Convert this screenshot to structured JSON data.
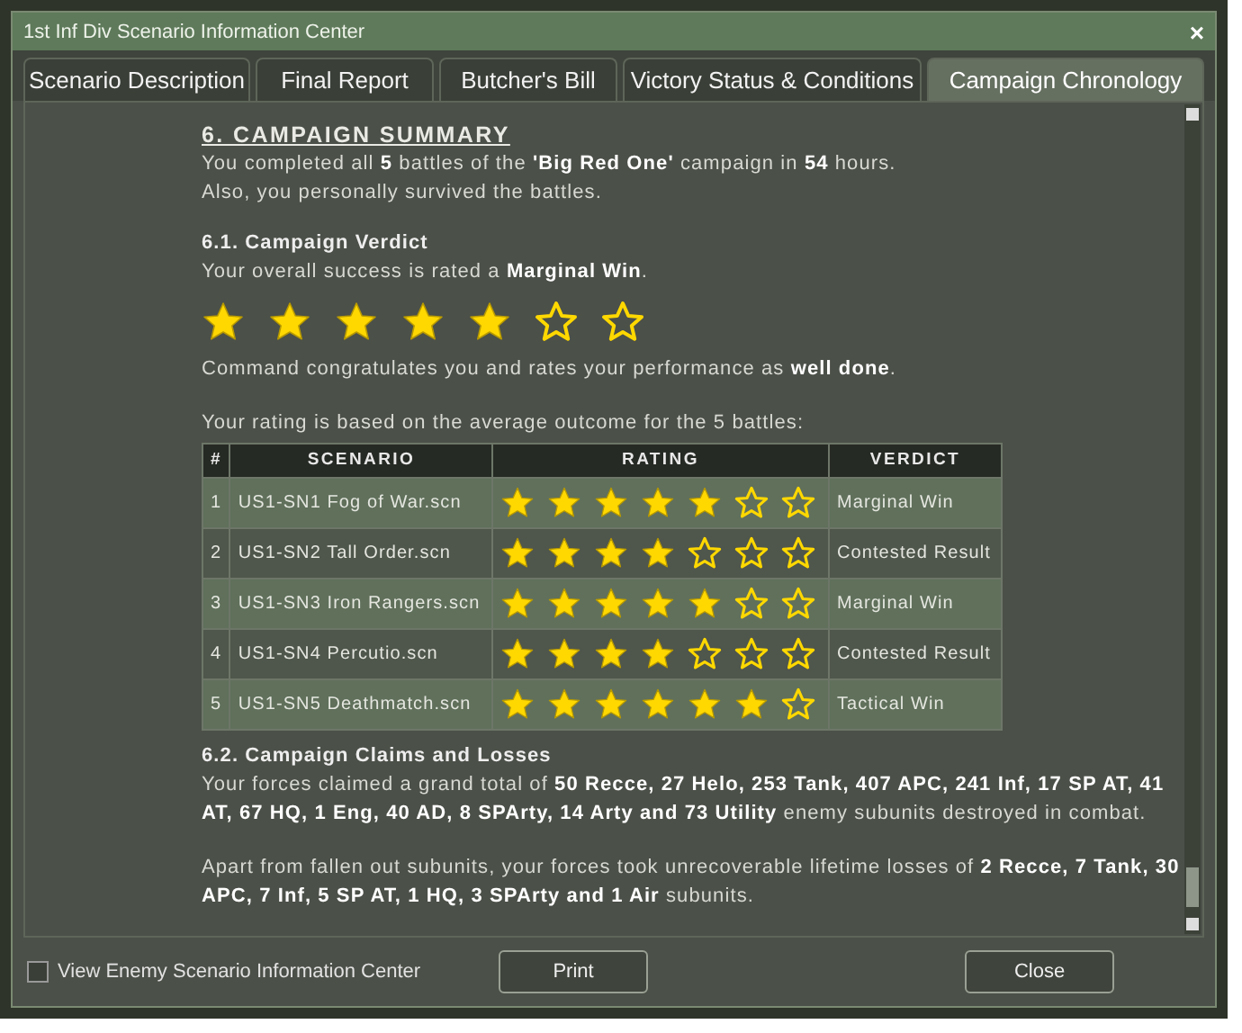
{
  "window": {
    "title": "1st Inf Div Scenario Information Center",
    "close": "×"
  },
  "tabs": [
    {
      "label": "Scenario Description",
      "selected": false
    },
    {
      "label": "Final Report",
      "selected": false
    },
    {
      "label": "Butcher's Bill",
      "selected": false
    },
    {
      "label": "Victory Status & Conditions",
      "selected": false
    },
    {
      "label": "Campaign Chronology",
      "selected": true
    }
  ],
  "summary": {
    "heading": "6. CAMPAIGN SUMMARY",
    "lines": [
      "You completed all **5** battles of the **'Big Red One'** campaign in **54** hours.",
      "Also, you personally survived the battles."
    ]
  },
  "verdict": {
    "heading": "6.1. Campaign Verdict",
    "text": "Your overall success is rated a **Marginal Win**.",
    "stars": 5,
    "comment": "Command congratulates you and rates your performance as **well done**.",
    "intro": "Your rating is based on the average outcome for the 5 battles:"
  },
  "table": {
    "columns": [
      "#",
      "SCENARIO",
      "RATING",
      "VERDICT"
    ],
    "rows": [
      {
        "index": "1",
        "scenario": "US1-SN1 Fog of War.scn",
        "stars": 5,
        "verdict": "Marginal Win"
      },
      {
        "index": "2",
        "scenario": "US1-SN2 Tall Order.scn",
        "stars": 4,
        "verdict": "Contested Result"
      },
      {
        "index": "3",
        "scenario": "US1-SN3 Iron Rangers.scn",
        "stars": 5,
        "verdict": "Marginal Win"
      },
      {
        "index": "4",
        "scenario": "US1-SN4 Percutio.scn",
        "stars": 4,
        "verdict": "Contested Result"
      },
      {
        "index": "5",
        "scenario": "US1-SN5 Deathmatch.scn",
        "stars": 6,
        "verdict": "Tactical Win"
      }
    ]
  },
  "claims": {
    "heading": "6.2. Campaign Claims and Losses",
    "paragraphs": [
      "Your forces claimed a grand total of **50 Recce, 27 Helo, 253 Tank, 407 APC, 241 Inf, 17 SP AT, 41 AT, 67 HQ, 1 Eng, 40 AD, 8 SPArty, 14 Arty and 73 Utility** enemy subunits destroyed in combat.",
      "Apart from fallen out subunits, your forces took unrecoverable lifetime losses of **2 Recce, 7 Tank, 30 APC, 7 Inf, 5 SP AT, 1 HQ, 3 SPArty and 1 Air** subunits."
    ]
  },
  "footer": {
    "checkbox": {
      "label": "View Enemy Scenario Information Center",
      "checked": false
    },
    "buttons": [
      "Print",
      "Close"
    ]
  }
}
